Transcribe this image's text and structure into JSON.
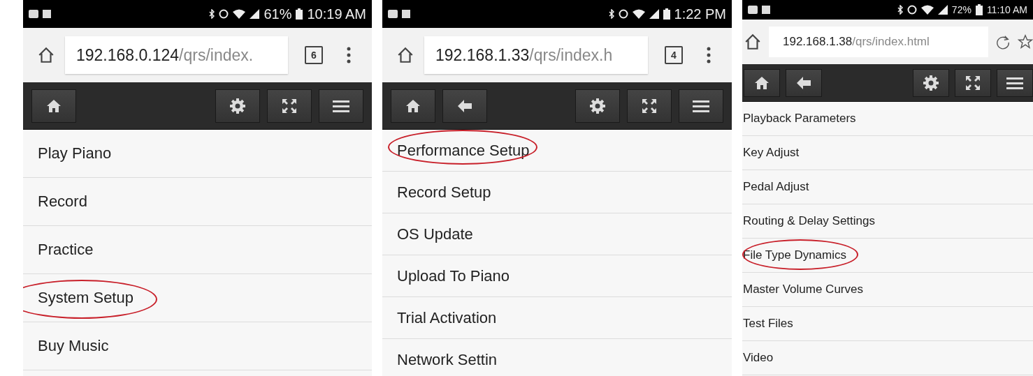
{
  "screens": [
    {
      "status_bar": {
        "battery": "61%",
        "time": "10:19 AM"
      },
      "address_bar": {
        "host": "192.168.0.124",
        "path": "/qrs/index.",
        "tab_count": "6"
      },
      "toolbar": [
        {
          "kind": "home"
        },
        {
          "kind": "settings"
        },
        {
          "kind": "fullscreen"
        },
        {
          "kind": "menu"
        }
      ],
      "menu_items": [
        {
          "label": "Play Piano",
          "circled": false
        },
        {
          "label": "Record",
          "circled": false
        },
        {
          "label": "Practice",
          "circled": false
        },
        {
          "label": "System Setup",
          "circled": true
        },
        {
          "label": "Buy Music",
          "circled": false
        }
      ]
    },
    {
      "status_bar": {
        "time": "1:22 PM"
      },
      "address_bar": {
        "host": "192.168.1.33",
        "path": "/qrs/index.h",
        "tab_count": "4"
      },
      "toolbar": [
        {
          "kind": "home"
        },
        {
          "kind": "back"
        },
        {
          "kind": "settings"
        },
        {
          "kind": "fullscreen"
        },
        {
          "kind": "menu"
        }
      ],
      "menu_items": [
        {
          "label": "Performance Setup",
          "circled": true
        },
        {
          "label": "Record Setup",
          "circled": false
        },
        {
          "label": "OS Update",
          "circled": false
        },
        {
          "label": "Upload To Piano",
          "circled": false
        },
        {
          "label": "Trial Activation",
          "circled": false
        },
        {
          "label": "Network Settin",
          "circled": false
        }
      ]
    },
    {
      "status_bar": {
        "battery": "72%",
        "time": "11:10 AM"
      },
      "address_bar": {
        "host": "192.168.1.38",
        "path": "/qrs/index.html"
      },
      "toolbar": [
        {
          "kind": "home"
        },
        {
          "kind": "back"
        },
        {
          "kind": "settings"
        },
        {
          "kind": "fullscreen"
        },
        {
          "kind": "menu"
        }
      ],
      "menu_items": [
        {
          "label": "Playback Parameters",
          "circled": false
        },
        {
          "label": "Key Adjust",
          "circled": false
        },
        {
          "label": "Pedal Adjust",
          "circled": false
        },
        {
          "label": "Routing & Delay Settings",
          "circled": false
        },
        {
          "label": "File Type Dynamics",
          "circled": true
        },
        {
          "label": "Master Volume Curves",
          "circled": false
        },
        {
          "label": "Test Files",
          "circled": false
        },
        {
          "label": "Video",
          "circled": false
        }
      ]
    }
  ]
}
